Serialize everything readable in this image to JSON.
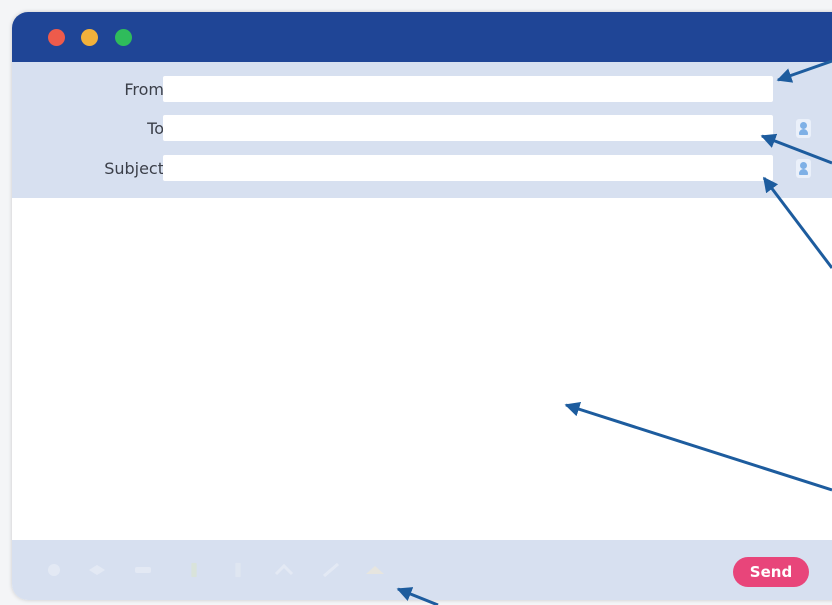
{
  "window": {
    "controls": [
      "close",
      "minimize",
      "zoom"
    ]
  },
  "fields": {
    "from_label": "From",
    "from_value": "",
    "to_label": "To",
    "to_value": "",
    "subject_label": "Subject",
    "subject_value": ""
  },
  "body": {
    "value": ""
  },
  "toolbar": {
    "icons": [
      "attachment-icon",
      "link-icon",
      "text-format-icon",
      "bold-icon",
      "italic-icon",
      "underline-icon",
      "edit-icon",
      "emoji-icon"
    ],
    "send_label": "Send"
  },
  "colors": {
    "titlebar": "#1f4596",
    "header": "#d7e0f0",
    "send": "#e8457a",
    "arrow": "#1d5c9e"
  }
}
